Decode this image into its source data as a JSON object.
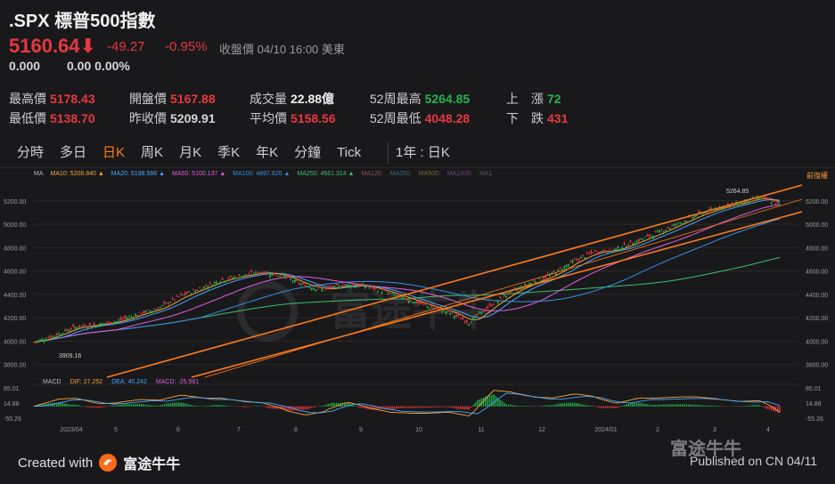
{
  "header": {
    "symbol_name": ".SPX 標普500指數",
    "price": "5160.64",
    "price_arrow": "⬇",
    "change": "-49.27",
    "change_pct": "-0.95%",
    "status": "收盤價 04/10 16:00 美東",
    "sub_value1": "0.000",
    "sub_value2": "0.00 0.00%"
  },
  "stats": [
    {
      "label": "最高價",
      "value": "5178.43",
      "color": "#e8373f"
    },
    {
      "label": "開盤價",
      "value": "5167.88",
      "color": "#e8373f"
    },
    {
      "label": "成交量",
      "value": "22.88億",
      "color": "#f0f0f0"
    },
    {
      "label": "52周最高",
      "value": "5264.85",
      "color": "#23b24c"
    },
    {
      "label": "上　漲",
      "value": "72",
      "color": "#23b24c"
    },
    {
      "label": "最低價",
      "value": "5138.70",
      "color": "#e8373f"
    },
    {
      "label": "昨收價",
      "value": "5209.91",
      "color": "#d6d6d6"
    },
    {
      "label": "平均價",
      "value": "5158.56",
      "color": "#e8373f"
    },
    {
      "label": "52周最低",
      "value": "4048.28",
      "color": "#e8373f"
    },
    {
      "label": "下　跌",
      "value": "431",
      "color": "#e8373f"
    }
  ],
  "tabs": [
    "分時",
    "多日",
    "日K",
    "周K",
    "月K",
    "季K",
    "年K",
    "分鐘",
    "Tick"
  ],
  "active_tab": "日K",
  "range_label": "1年 : 日K",
  "ma_legend": [
    {
      "text": "MA",
      "color": "#bbbbbb"
    },
    {
      "text": "MA10: 5208.840 ▲",
      "color": "#f3a53a"
    },
    {
      "text": "MA20: 5198.566 ▲",
      "color": "#4aa3ff"
    },
    {
      "text": "MA50: 5100.137 ▲",
      "color": "#e060e0"
    },
    {
      "text": "MA100: 4897.820 ▲",
      "color": "#3b8ee8"
    },
    {
      "text": "MA250: 4561.314 ▲",
      "color": "#3fbf6f"
    },
    {
      "text": "MA120:",
      "color": "#8a5a5a"
    },
    {
      "text": "MA250:",
      "color": "#3a6a7a"
    },
    {
      "text": "MA500:",
      "color": "#7a6a3a"
    },
    {
      "text": "MA1000:",
      "color": "#6a4a7a"
    },
    {
      "text": "MA1",
      "color": "#555555"
    }
  ],
  "fq_label": "前復權",
  "macd_legend": [
    {
      "text": "MACD",
      "color": "#bbbbbb"
    },
    {
      "text": "DIF: 27.252",
      "color": "#f3a53a"
    },
    {
      "text": "DEA: 40.242",
      "color": "#4aa3ff"
    },
    {
      "text": "MACD: -25.981",
      "color": "#e060e0"
    }
  ],
  "watermark_text": "富途牛牛",
  "footer": {
    "created_with": "Created with",
    "brand": "富途牛牛",
    "published": "Published on CN 04/11"
  },
  "chart_data": {
    "type": "candlestick",
    "y_ticks": [
      "5200.00",
      "5000.00",
      "4800.00",
      "4600.00",
      "4400.00",
      "4200.00",
      "4000.00",
      "3800.00"
    ],
    "ylim": [
      3760,
      5320
    ],
    "x_labels": [
      "2023/04",
      "5",
      "6",
      "7",
      "8",
      "9",
      "10",
      "11",
      "12",
      "2024/01",
      "2",
      "3",
      "4"
    ],
    "annotations": {
      "high": "5264.85",
      "low": "3909.16"
    },
    "close_path": [
      [
        0,
        3990
      ],
      [
        10,
        4050
      ],
      [
        20,
        4120
      ],
      [
        30,
        4140
      ],
      [
        40,
        4170
      ],
      [
        50,
        4230
      ],
      [
        60,
        4280
      ],
      [
        70,
        4380
      ],
      [
        80,
        4450
      ],
      [
        90,
        4520
      ],
      [
        100,
        4560
      ],
      [
        110,
        4590
      ],
      [
        120,
        4560
      ],
      [
        130,
        4480
      ],
      [
        140,
        4440
      ],
      [
        150,
        4480
      ],
      [
        160,
        4470
      ],
      [
        170,
        4420
      ],
      [
        180,
        4360
      ],
      [
        190,
        4300
      ],
      [
        200,
        4250
      ],
      [
        210,
        4160
      ],
      [
        220,
        4300
      ],
      [
        230,
        4420
      ],
      [
        240,
        4500
      ],
      [
        250,
        4570
      ],
      [
        260,
        4680
      ],
      [
        270,
        4760
      ],
      [
        280,
        4780
      ],
      [
        290,
        4850
      ],
      [
        300,
        4920
      ],
      [
        310,
        5000
      ],
      [
        320,
        5080
      ],
      [
        330,
        5140
      ],
      [
        340,
        5180
      ],
      [
        350,
        5230
      ],
      [
        355,
        5205
      ],
      [
        360,
        5160
      ]
    ],
    "macd_ticks": [
      "85.01",
      "14.88",
      "-55.26"
    ]
  }
}
